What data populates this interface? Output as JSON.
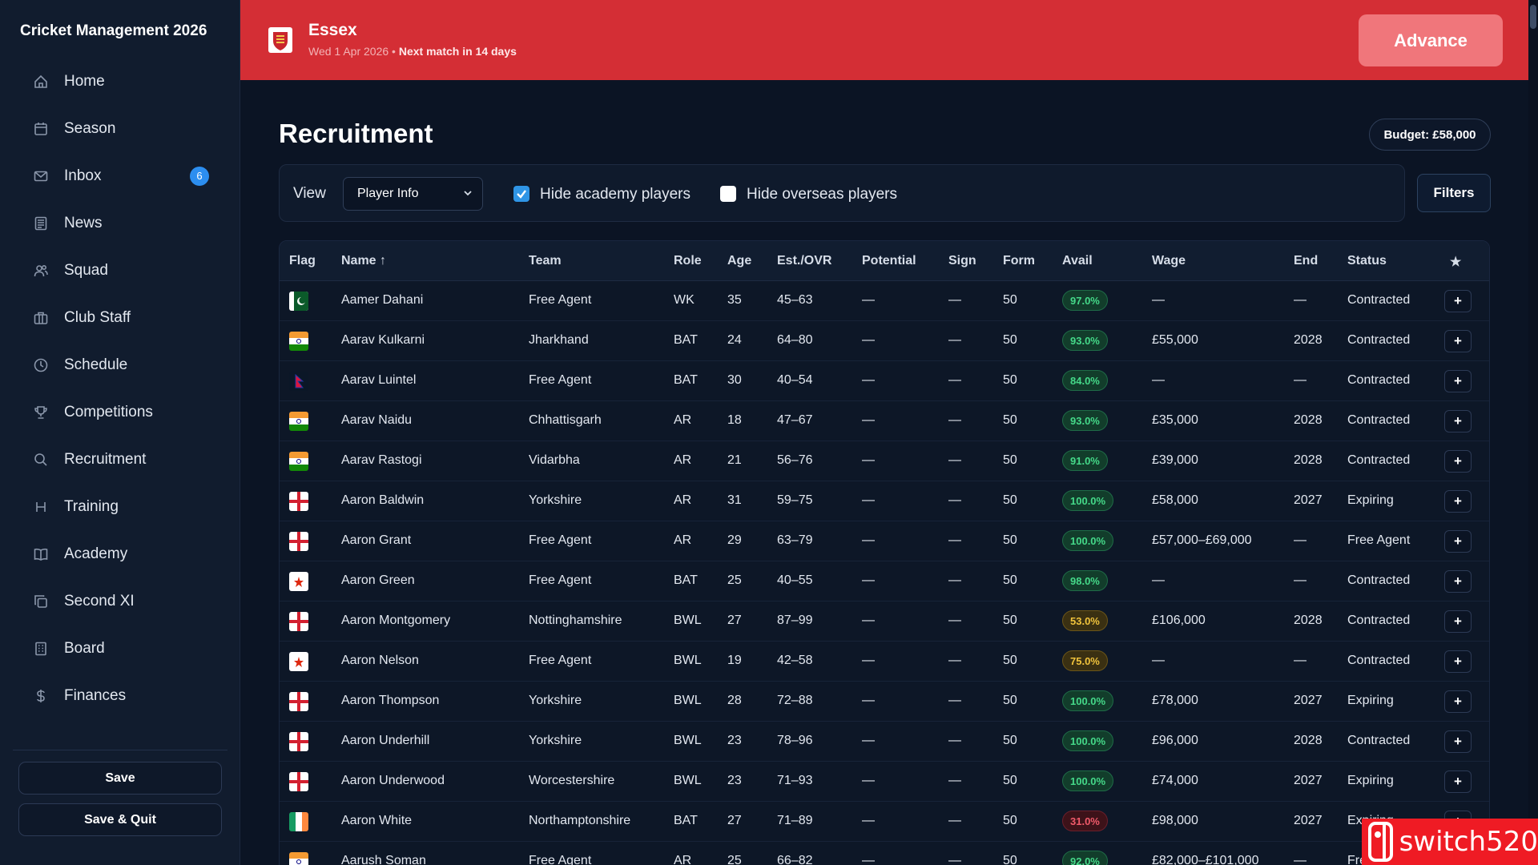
{
  "app": {
    "title": "Cricket Management 2026"
  },
  "sidebar": {
    "items": [
      {
        "label": "Home",
        "icon": "home-icon"
      },
      {
        "label": "Season",
        "icon": "calendar-icon"
      },
      {
        "label": "Inbox",
        "icon": "mail-icon",
        "badge": "6"
      },
      {
        "label": "News",
        "icon": "newspaper-icon"
      },
      {
        "label": "Squad",
        "icon": "users-icon"
      },
      {
        "label": "Club Staff",
        "icon": "briefcase-icon"
      },
      {
        "label": "Schedule",
        "icon": "clock-icon"
      },
      {
        "label": "Competitions",
        "icon": "trophy-icon"
      },
      {
        "label": "Recruitment",
        "icon": "search-icon"
      },
      {
        "label": "Training",
        "icon": "dumbbell-icon"
      },
      {
        "label": "Academy",
        "icon": "book-icon"
      },
      {
        "label": "Second XI",
        "icon": "copy-icon"
      },
      {
        "label": "Board",
        "icon": "building-icon"
      },
      {
        "label": "Finances",
        "icon": "dollar-icon"
      }
    ],
    "save_label": "Save",
    "save_quit_label": "Save & Quit"
  },
  "header": {
    "club": "Essex",
    "date": "Wed 1 Apr 2026",
    "separator": " • ",
    "next_match": "Next match in 14 days",
    "advance_label": "Advance"
  },
  "page": {
    "title": "Recruitment",
    "budget": "Budget: £58,000"
  },
  "toolbar": {
    "view_label": "View",
    "view_selected": "Player Info",
    "hide_academy_label": "Hide academy players",
    "hide_academy_checked": true,
    "hide_overseas_label": "Hide overseas players",
    "hide_overseas_checked": false,
    "filters_label": "Filters"
  },
  "table": {
    "columns": [
      "Flag",
      "Name ↑",
      "Team",
      "Role",
      "Age",
      "Est./OVR",
      "Potential",
      "Sign",
      "Form",
      "Avail",
      "Wage",
      "End",
      "Status",
      "★"
    ],
    "rows": [
      {
        "flag": "pakistan",
        "name": "Aamer Dahani",
        "team": "Free Agent",
        "role": "WK",
        "age": "35",
        "ovr": "45–63",
        "potential": "—",
        "sign": "—",
        "form": "50",
        "avail": "97.0%",
        "avail_level": "good",
        "wage": "—",
        "end": "—",
        "status": "Contracted"
      },
      {
        "flag": "india",
        "name": "Aarav Kulkarni",
        "team": "Jharkhand",
        "role": "BAT",
        "age": "24",
        "ovr": "64–80",
        "potential": "—",
        "sign": "—",
        "form": "50",
        "avail": "93.0%",
        "avail_level": "good",
        "wage": "£55,000",
        "end": "2028",
        "status": "Contracted"
      },
      {
        "flag": "nepal",
        "name": "Aarav Luintel",
        "team": "Free Agent",
        "role": "BAT",
        "age": "30",
        "ovr": "40–54",
        "potential": "—",
        "sign": "—",
        "form": "50",
        "avail": "84.0%",
        "avail_level": "good",
        "wage": "—",
        "end": "—",
        "status": "Contracted"
      },
      {
        "flag": "india",
        "name": "Aarav Naidu",
        "team": "Chhattisgarh",
        "role": "AR",
        "age": "18",
        "ovr": "47–67",
        "potential": "—",
        "sign": "—",
        "form": "50",
        "avail": "93.0%",
        "avail_level": "good",
        "wage": "£35,000",
        "end": "2028",
        "status": "Contracted"
      },
      {
        "flag": "india",
        "name": "Aarav Rastogi",
        "team": "Vidarbha",
        "role": "AR",
        "age": "21",
        "ovr": "56–76",
        "potential": "—",
        "sign": "—",
        "form": "50",
        "avail": "91.0%",
        "avail_level": "good",
        "wage": "£39,000",
        "end": "2028",
        "status": "Contracted"
      },
      {
        "flag": "england",
        "name": "Aaron Baldwin",
        "team": "Yorkshire",
        "role": "AR",
        "age": "31",
        "ovr": "59–75",
        "potential": "—",
        "sign": "—",
        "form": "50",
        "avail": "100.0%",
        "avail_level": "good",
        "wage": "£58,000",
        "end": "2027",
        "status": "Expiring"
      },
      {
        "flag": "england",
        "name": "Aaron Grant",
        "team": "Free Agent",
        "role": "AR",
        "age": "29",
        "ovr": "63–79",
        "potential": "—",
        "sign": "—",
        "form": "50",
        "avail": "100.0%",
        "avail_level": "good",
        "wage": "£57,000–£69,000",
        "end": "—",
        "status": "Free Agent"
      },
      {
        "flag": "hongkong",
        "name": "Aaron Green",
        "team": "Free Agent",
        "role": "BAT",
        "age": "25",
        "ovr": "40–55",
        "potential": "—",
        "sign": "—",
        "form": "50",
        "avail": "98.0%",
        "avail_level": "good",
        "wage": "—",
        "end": "—",
        "status": "Contracted"
      },
      {
        "flag": "england",
        "name": "Aaron Montgomery",
        "team": "Nottinghamshire",
        "role": "BWL",
        "age": "27",
        "ovr": "87–99",
        "potential": "—",
        "sign": "—",
        "form": "50",
        "avail": "53.0%",
        "avail_level": "mid",
        "wage": "£106,000",
        "end": "2028",
        "status": "Contracted"
      },
      {
        "flag": "hongkong",
        "name": "Aaron Nelson",
        "team": "Free Agent",
        "role": "BWL",
        "age": "19",
        "ovr": "42–58",
        "potential": "—",
        "sign": "—",
        "form": "50",
        "avail": "75.0%",
        "avail_level": "mid",
        "wage": "—",
        "end": "—",
        "status": "Contracted"
      },
      {
        "flag": "england",
        "name": "Aaron Thompson",
        "team": "Yorkshire",
        "role": "BWL",
        "age": "28",
        "ovr": "72–88",
        "potential": "—",
        "sign": "—",
        "form": "50",
        "avail": "100.0%",
        "avail_level": "good",
        "wage": "£78,000",
        "end": "2027",
        "status": "Expiring"
      },
      {
        "flag": "england",
        "name": "Aaron Underhill",
        "team": "Yorkshire",
        "role": "BWL",
        "age": "23",
        "ovr": "78–96",
        "potential": "—",
        "sign": "—",
        "form": "50",
        "avail": "100.0%",
        "avail_level": "good",
        "wage": "£96,000",
        "end": "2028",
        "status": "Contracted"
      },
      {
        "flag": "england",
        "name": "Aaron Underwood",
        "team": "Worcestershire",
        "role": "BWL",
        "age": "23",
        "ovr": "71–93",
        "potential": "—",
        "sign": "—",
        "form": "50",
        "avail": "100.0%",
        "avail_level": "good",
        "wage": "£74,000",
        "end": "2027",
        "status": "Expiring"
      },
      {
        "flag": "ireland",
        "name": "Aaron White",
        "team": "Northamptonshire",
        "role": "BAT",
        "age": "27",
        "ovr": "71–89",
        "potential": "—",
        "sign": "—",
        "form": "50",
        "avail": "31.0%",
        "avail_level": "low",
        "wage": "£98,000",
        "end": "2027",
        "status": "Expiring"
      },
      {
        "flag": "india",
        "name": "Aarush Soman",
        "team": "Free Agent",
        "role": "AR",
        "age": "25",
        "ovr": "66–82",
        "potential": "—",
        "sign": "—",
        "form": "50",
        "avail": "92.0%",
        "avail_level": "good",
        "wage": "£82,000–£101,000",
        "end": "—",
        "status": "Free Agent"
      }
    ],
    "add_label": "+"
  },
  "watermark": {
    "text": "switch520"
  },
  "colors": {
    "accent_red": "#d42e35",
    "advance": "#f0767b",
    "checkbox_blue": "#2f95e6",
    "good": "#45d989",
    "mid": "#f0c33c",
    "low": "#f05a6a"
  }
}
